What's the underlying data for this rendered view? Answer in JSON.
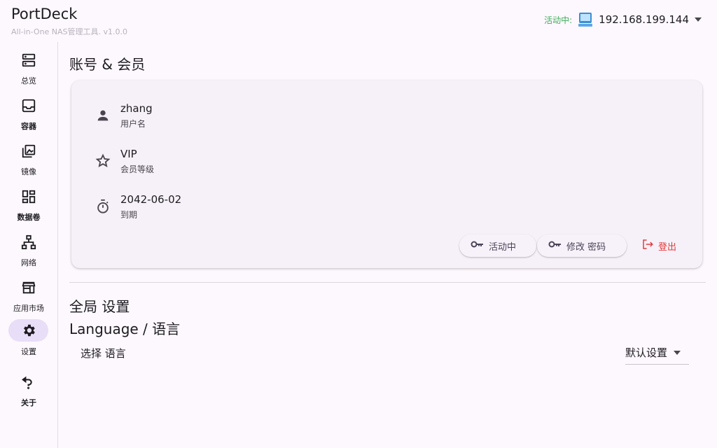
{
  "header": {
    "title": "PortDeck",
    "subtitle": "All-in-One NAS管理工具. v1.0.0",
    "status_label": "活动中:",
    "host_ip": "192.168.199.144"
  },
  "sidebar": {
    "items": [
      {
        "label": "总览",
        "icon": "server-icon"
      },
      {
        "label": "容器",
        "icon": "inbox-icon"
      },
      {
        "label": "镜像",
        "icon": "images-icon"
      },
      {
        "label": "数据卷",
        "icon": "dashboard-icon"
      },
      {
        "label": "网络",
        "icon": "network-icon"
      },
      {
        "label": "应用市场",
        "icon": "store-icon"
      },
      {
        "label": "设置",
        "icon": "gear-icon"
      },
      {
        "label": "关于",
        "icon": "help-icon"
      }
    ],
    "active_index": 6
  },
  "account": {
    "title": "账号 & 会员",
    "username": {
      "value": "zhang",
      "caption": "用户名"
    },
    "level": {
      "value": "VIP",
      "caption": "会员等级"
    },
    "expiry": {
      "value": "2042-06-02",
      "caption": "到期"
    },
    "buttons": {
      "active": "活动中",
      "change_password": "修改 密码",
      "logout": "登出"
    }
  },
  "settings": {
    "title": "全局 设置",
    "language_title": "Language / 语言",
    "language_label": "选择 语言",
    "language_value": "默认设置"
  },
  "colors": {
    "accent": "#e8def8",
    "status": "#3fae5a",
    "logout": "#e23b3b"
  }
}
